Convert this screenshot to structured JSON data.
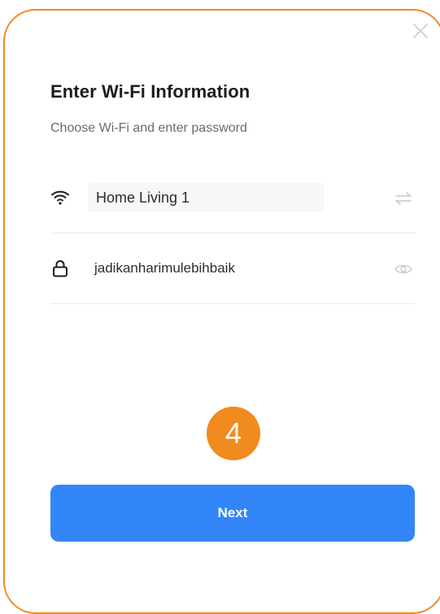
{
  "dialog": {
    "title": "Enter Wi-Fi Information",
    "subtitle": "Choose Wi-Fi and enter password"
  },
  "wifi": {
    "network_name": "Home Living 1",
    "icon": "wifi-icon",
    "switch_icon": "switch-network-icon"
  },
  "password": {
    "value": "jadikanharimulebihbaik",
    "icon": "lock-icon",
    "toggle_icon": "eye-icon"
  },
  "step": {
    "number": "4",
    "color": "#F18A1F"
  },
  "actions": {
    "next_label": "Next",
    "primary_color": "#3386F7"
  },
  "frame": {
    "border_color": "#F08A24"
  }
}
